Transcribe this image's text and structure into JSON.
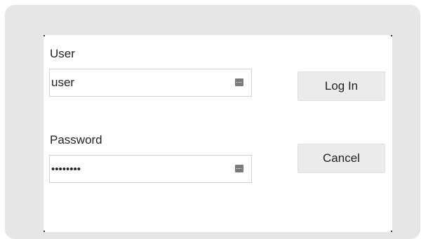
{
  "login": {
    "user_label": "User",
    "user_value": "user",
    "password_label": "Password",
    "password_value": "••••••••",
    "login_button": "Log In",
    "cancel_button": "Cancel"
  },
  "icons": {
    "credential": "password-manager-key-icon"
  },
  "colors": {
    "background": "#e6e6e6",
    "panel": "#ffffff",
    "button": "#ebebeb",
    "input_border": "#cfcfcf"
  }
}
